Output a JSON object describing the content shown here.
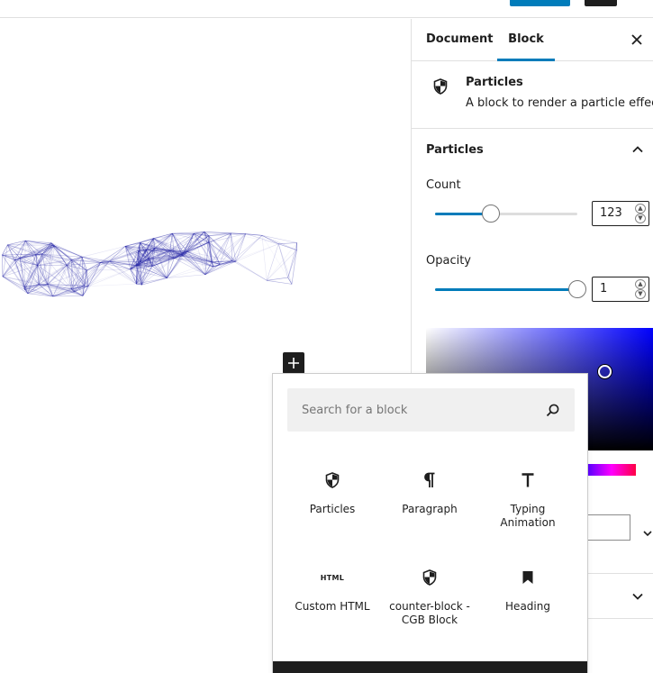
{
  "sidebar": {
    "tabs": [
      {
        "label": "Document"
      },
      {
        "label": "Block"
      }
    ],
    "block_card": {
      "title": "Particles",
      "description": "A block to render a particle effect"
    },
    "panel": {
      "title": "Particles",
      "count": {
        "label": "Count",
        "value": "123",
        "fraction": 0.39
      },
      "opacity": {
        "label": "Opacity",
        "value": "1",
        "fraction": 1.0
      }
    },
    "accent_color": "#007cba"
  },
  "inserter": {
    "search_placeholder": "Search for a block",
    "blocks": [
      {
        "label": "Particles",
        "icon": "shield-icon"
      },
      {
        "label": "Paragraph",
        "icon": "pilcrow-icon"
      },
      {
        "label": "Typing\nAnimation",
        "icon": "text-t-icon"
      },
      {
        "label": "Custom HTML",
        "icon": "html-icon",
        "icon_text": "HTML"
      },
      {
        "label": "counter-block -\nCGB Block",
        "icon": "shield-icon"
      },
      {
        "label": "Heading",
        "icon": "bookmark-icon"
      }
    ]
  }
}
